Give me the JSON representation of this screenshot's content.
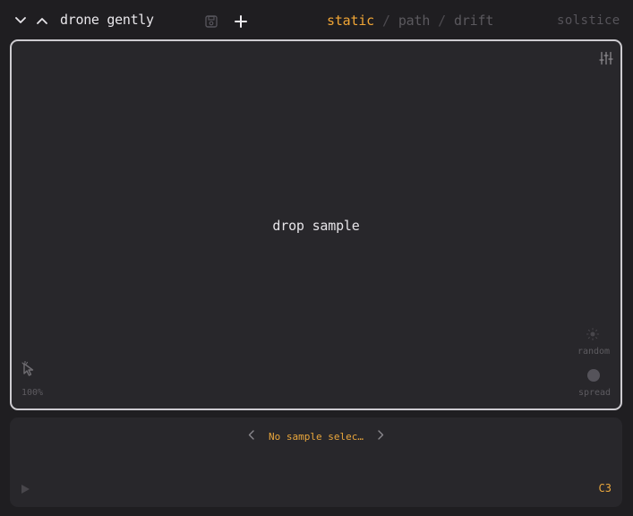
{
  "header": {
    "preset_name": "drone gently",
    "modes": [
      {
        "label": "static",
        "active": true
      },
      {
        "label": "path",
        "active": false
      },
      {
        "label": "drift",
        "active": false
      }
    ],
    "separator": "/",
    "brand": "solstice",
    "icons": {
      "collapse": "chevron-down-icon",
      "expand": "chevron-up-icon",
      "save": "save-icon",
      "add": "plus-icon"
    }
  },
  "drop_area": {
    "prompt": "drop sample",
    "zoom": "100%",
    "random_label": "random",
    "spread_label": "spread",
    "icons": {
      "settings": "sliders-icon",
      "pointer": "pointer-icon"
    }
  },
  "sample_bar": {
    "sample_name": "No sample selec…",
    "note": "C3",
    "icons": {
      "prev": "chevron-left-icon",
      "next": "chevron-right-icon",
      "play": "play-icon"
    }
  },
  "colors": {
    "accent": "#f0a535",
    "panel": "#28272b",
    "background": "#1f1e21",
    "border": "#cdcbd0"
  }
}
